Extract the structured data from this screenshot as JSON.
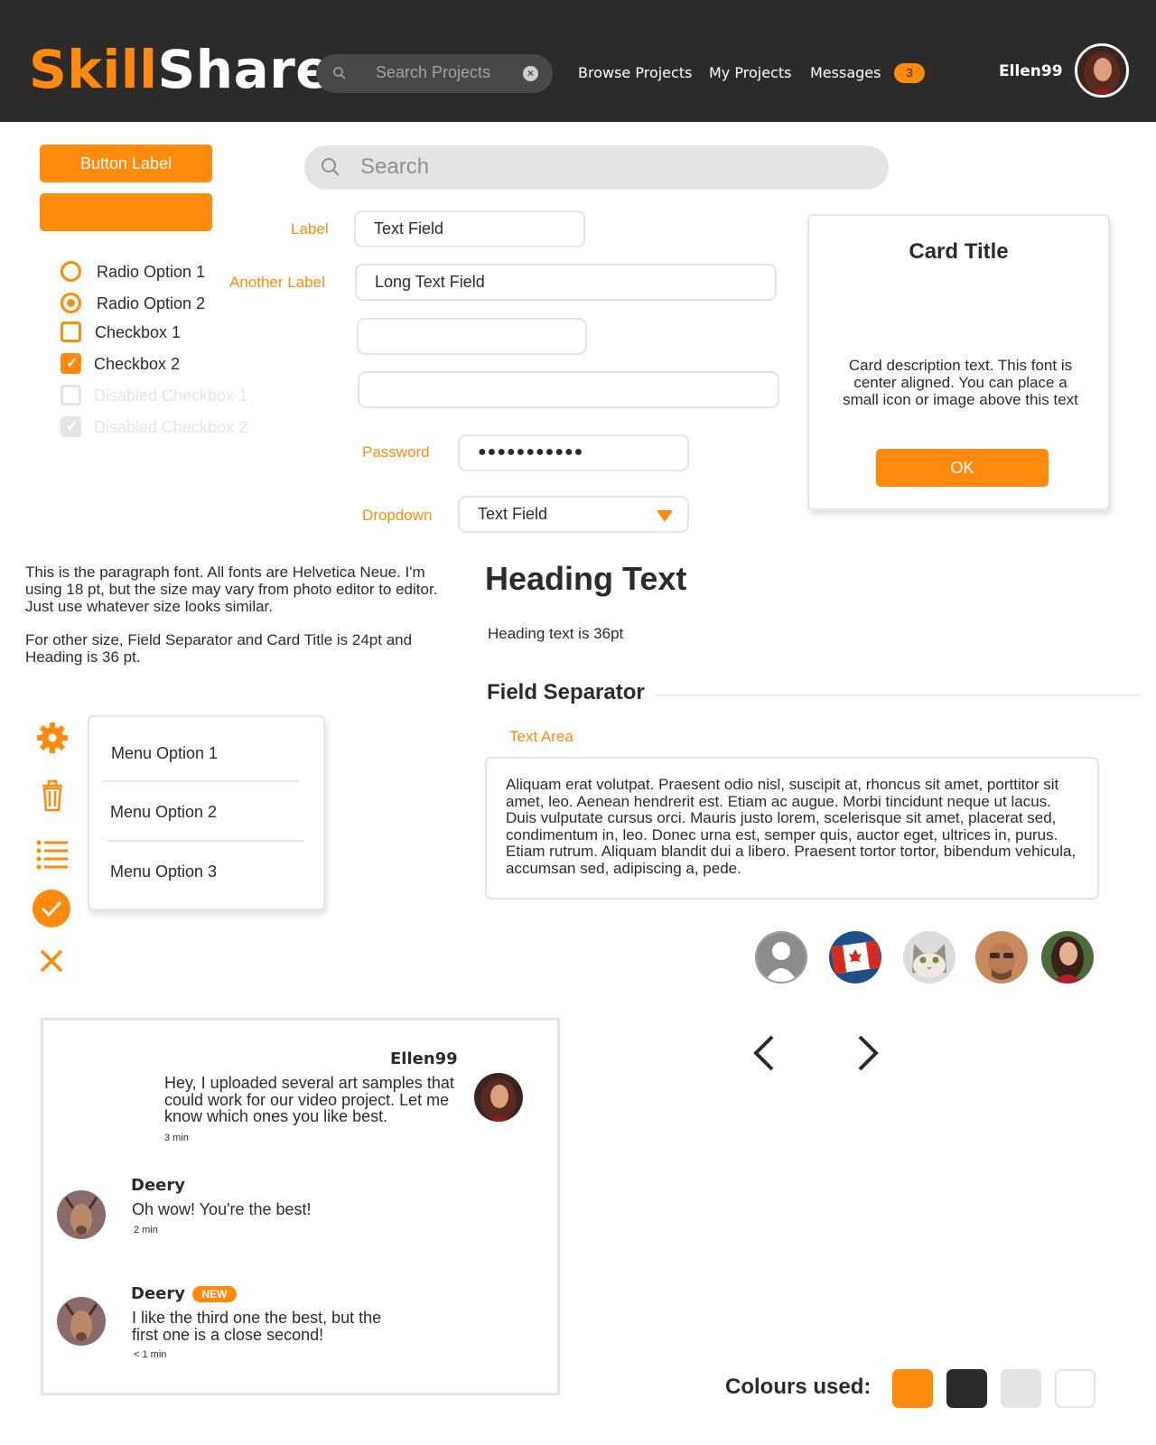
{
  "header": {
    "logo_part1": "Skill",
    "logo_part2": "Share",
    "search_placeholder": "Search Projects",
    "nav": [
      "Browse Projects",
      "My Projects",
      "Messages"
    ],
    "messages_badge": "3",
    "username": "Ellen99"
  },
  "buttons": {
    "primary_label": "Button Label",
    "secondary_label": ""
  },
  "big_search": {
    "placeholder": "Search"
  },
  "options": [
    {
      "label": "Radio Option 1",
      "type": "radio",
      "selected": false
    },
    {
      "label": "Radio Option 2",
      "type": "radio",
      "selected": true
    },
    {
      "label": "Checkbox 1",
      "type": "checkbox",
      "checked": false
    },
    {
      "label": "Checkbox 2",
      "type": "checkbox",
      "checked": true
    },
    {
      "label": "Disabled Checkbox 1",
      "type": "checkbox",
      "checked": false,
      "disabled": true
    },
    {
      "label": "Disabled Checkbox 2",
      "type": "checkbox",
      "checked": true,
      "disabled": true
    }
  ],
  "form": {
    "label_1": "Label",
    "text_field": "Text Field",
    "label_2": "Another Label",
    "long_text_field": "Long Text Field",
    "empty_field_1": "",
    "empty_field_2": "",
    "password_label": "Password",
    "password_value": "●●●●●●●●●●●",
    "dropdown_label": "Dropdown",
    "dropdown_value": "Text Field"
  },
  "card": {
    "title": "Card Title",
    "description": "Card description text. This font is center aligned. You can place a small icon or image above this text",
    "button": "OK"
  },
  "paragraph": {
    "p1": "This is the paragraph font. All fonts are Helvetica Neue. I'm using 18 pt, but the size may vary from photo editor to editor. Just use whatever size looks similar.",
    "p2": "For other size, Field Separator and Card Title is 24pt and Heading is 36 pt."
  },
  "heading": {
    "text": "Heading Text",
    "note": "Heading text is 36pt"
  },
  "field_separator": "Field Separator",
  "text_area": {
    "label": "Text Area",
    "value": "Aliquam erat volutpat. Praesent odio nisl, suscipit at, rhoncus sit amet, porttitor sit amet, leo. Aenean hendrerit est. Etiam ac augue. Morbi tincidunt neque ut lacus. Duis vulputate cursus orci. Mauris justo lorem, scelerisque sit amet, placerat sed, condimentum in, leo. Donec urna est, semper quis, auctor eget, ultrices in, purus. Etiam rutrum. Aliquam blandit dui a libero. Praesent tortor tortor, bibendum vehicula, accumsan sed, adipiscing a, pede."
  },
  "side_icons": [
    "gear-icon",
    "trash-icon",
    "list-icon",
    "check-circle-icon",
    "close-icon"
  ],
  "menu": [
    "Menu Option 1",
    "Menu Option 2",
    "Menu Option 3"
  ],
  "avatars": [
    "default-user",
    "canada-flag",
    "cat",
    "man-sunglasses",
    "woman"
  ],
  "chat": {
    "messages": [
      {
        "name": "Ellen99",
        "text": "Hey, I uploaded several art samples that could work for our video project. Let me know which ones you like best.",
        "time": "3 min"
      },
      {
        "name": "Deery",
        "text": "Oh wow! You're the best!",
        "time": "2 min"
      },
      {
        "name": "Deery",
        "badge": "NEW",
        "text": "I like the third one the best, but the first one is a close second!",
        "time": "< 1 min"
      }
    ]
  },
  "colours": {
    "label": "Colours used:",
    "swatches": [
      "#ff8a0e",
      "#2d2a2a",
      "#e4e4e4",
      "#ffffff"
    ]
  }
}
